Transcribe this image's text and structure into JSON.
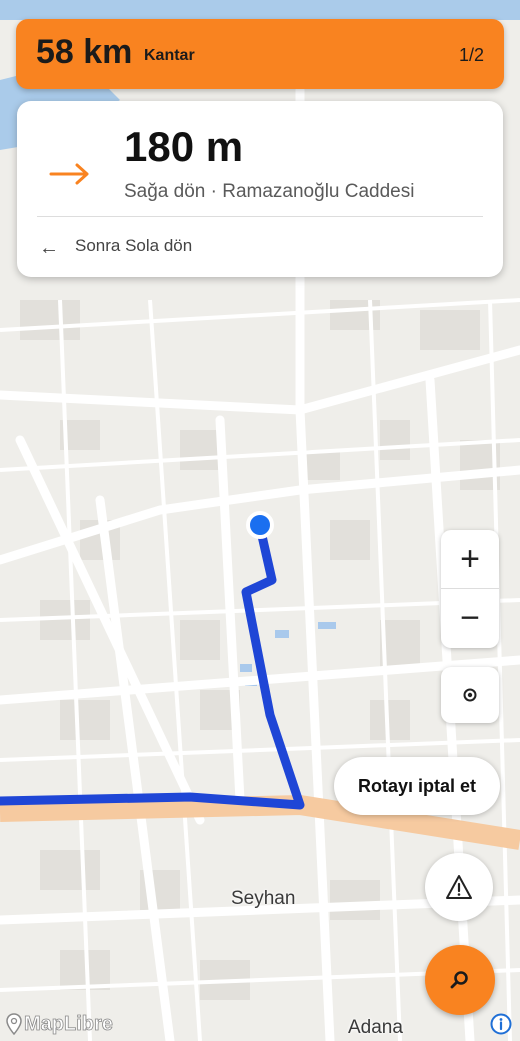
{
  "top_bar": {
    "distance": "58 km",
    "destination": "Kantar",
    "step": "1/2",
    "color": "#f98320"
  },
  "instruction": {
    "distance": "180 m",
    "text": "Sağa dön · Ramazanoğlu Caddesi",
    "turn_icon": "arrow-right-icon",
    "then_icon": "arrow-left-icon",
    "then_text": "Sonra Sola dön"
  },
  "map": {
    "labels": {
      "district": "Seyhan",
      "city": "Adana"
    },
    "route_color": "#1f46d6",
    "location_color": "#1a6ff0"
  },
  "controls": {
    "zoom_in": "+",
    "zoom_out": "−",
    "locate_icon": "target-icon",
    "cancel_route": "Rotayı iptal et",
    "report_icon": "warning-icon",
    "search_icon": "search-icon"
  },
  "attribution": {
    "text": "MapLibre",
    "info_icon": "info-icon"
  }
}
